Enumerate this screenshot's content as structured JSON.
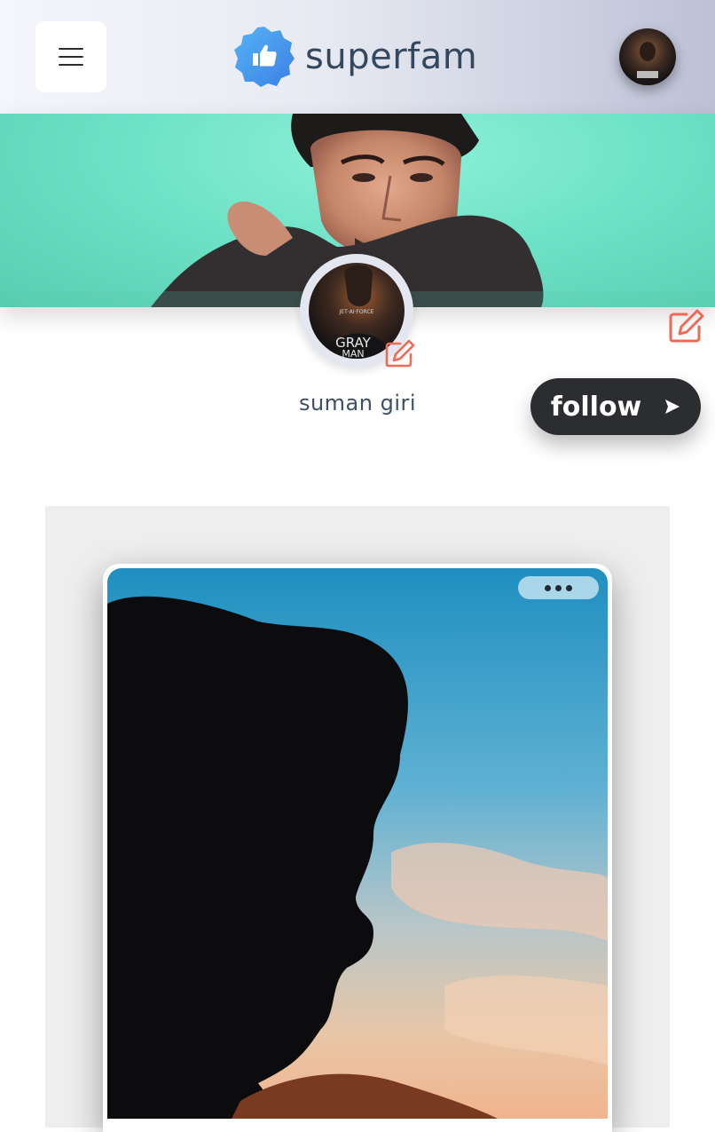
{
  "header": {
    "brand_name": "superfam",
    "menu_icon": "hamburger-menu-icon",
    "logo_icon": "thumbs-up-badge-icon",
    "brand_color": "#33475f",
    "logo_gradient": [
      "#4aa3f0",
      "#3d7ee6"
    ]
  },
  "profile": {
    "name": "suman giri",
    "avatar_poster": {
      "top_line": "JET·AI·FORCE",
      "title_line1": "GRAY",
      "title_line2": "MAN"
    },
    "edit_icon": "edit-pencil-icon",
    "accent_color": "#ee6a57"
  },
  "actions": {
    "follow_label": "follow",
    "follow_icon": "send-arrow-icon"
  },
  "post": {
    "more_icon": "more-dots-icon"
  }
}
